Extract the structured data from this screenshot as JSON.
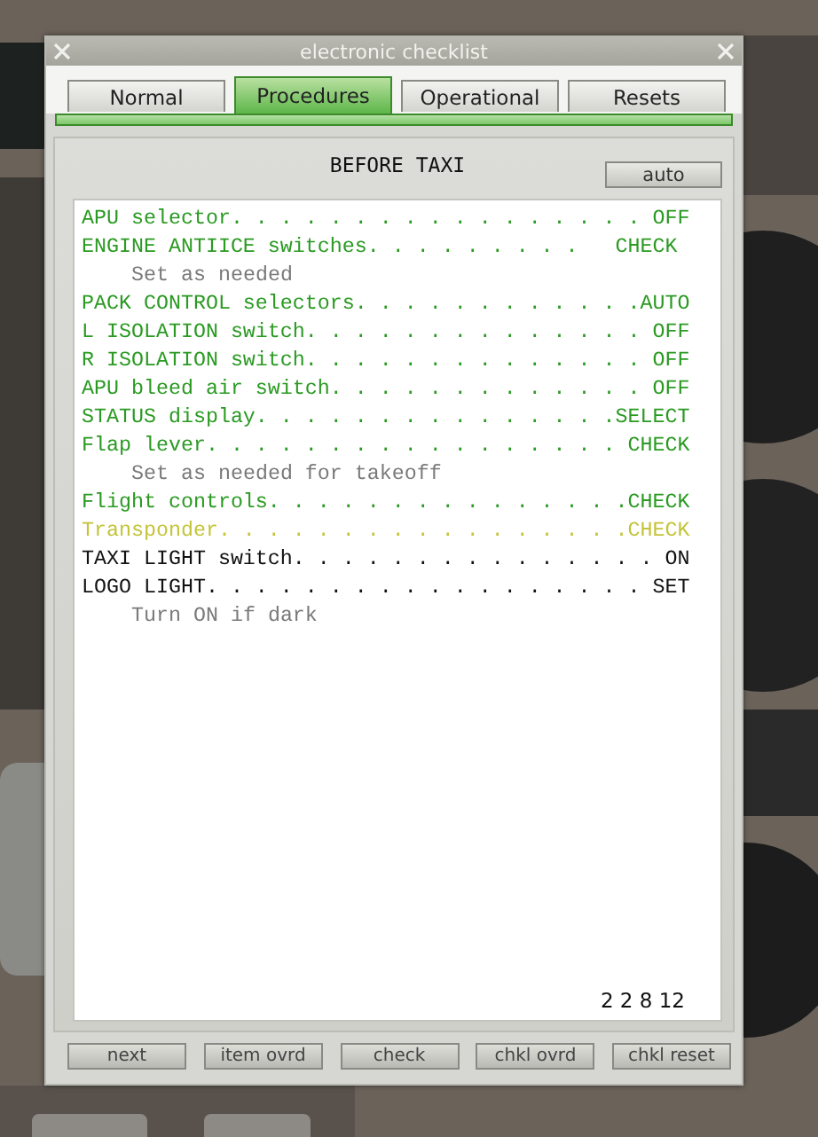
{
  "window": {
    "title": "electronic checklist"
  },
  "tabs": [
    {
      "label": "Normal",
      "selected": false
    },
    {
      "label": "Procedures",
      "selected": true
    },
    {
      "label": "Operational",
      "selected": false
    },
    {
      "label": "Resets",
      "selected": false
    }
  ],
  "checklist": {
    "title": "BEFORE TAXI",
    "auto_button": "auto",
    "items": [
      {
        "kind": "item",
        "checked": true,
        "current": false,
        "text": "APU selector. . . . . . . . . . . . . . . . . OFF"
      },
      {
        "kind": "item",
        "checked": true,
        "current": false,
        "text": "ENGINE ANTIICE switches. . . . . . . . .   CHECK"
      },
      {
        "kind": "note",
        "text": "Set as needed"
      },
      {
        "kind": "item",
        "checked": true,
        "current": false,
        "text": "PACK CONTROL selectors. . . . . . . . . . . .AUTO"
      },
      {
        "kind": "item",
        "checked": true,
        "current": false,
        "text": "L ISOLATION switch. . . . . . . . . . . . . . OFF"
      },
      {
        "kind": "item",
        "checked": true,
        "current": false,
        "text": "R ISOLATION switch. . . . . . . . . . . . . . OFF"
      },
      {
        "kind": "item",
        "checked": true,
        "current": false,
        "text": "APU bleed air switch. . . . . . . . . . . . . OFF"
      },
      {
        "kind": "item",
        "checked": true,
        "current": false,
        "text": "STATUS display. . . . . . . . . . . . . . .SELECT"
      },
      {
        "kind": "item",
        "checked": true,
        "current": false,
        "text": "Flap lever. . . . . . . . . . . . . . . . . CHECK"
      },
      {
        "kind": "note",
        "text": "Set as needed for takeoff"
      },
      {
        "kind": "item",
        "checked": true,
        "current": false,
        "text": "Flight controls. . . . . . . . . . . . . . .CHECK"
      },
      {
        "kind": "item",
        "checked": false,
        "current": true,
        "text": "Transponder. . . . . . . . . . . . . . . . .CHECK"
      },
      {
        "kind": "item",
        "checked": false,
        "current": false,
        "text": "TAXI LIGHT switch. . . . . . . . . . . . . . . ON"
      },
      {
        "kind": "item",
        "checked": false,
        "current": false,
        "text": "LOGO LIGHT. . . . . . . . . . . . . . . . . . SET"
      },
      {
        "kind": "note",
        "text": "Turn ON if dark"
      }
    ],
    "counter": "2 2 8 12"
  },
  "buttons": [
    "next",
    "item ovrd",
    "check",
    "chkl ovrd",
    "chkl reset"
  ]
}
